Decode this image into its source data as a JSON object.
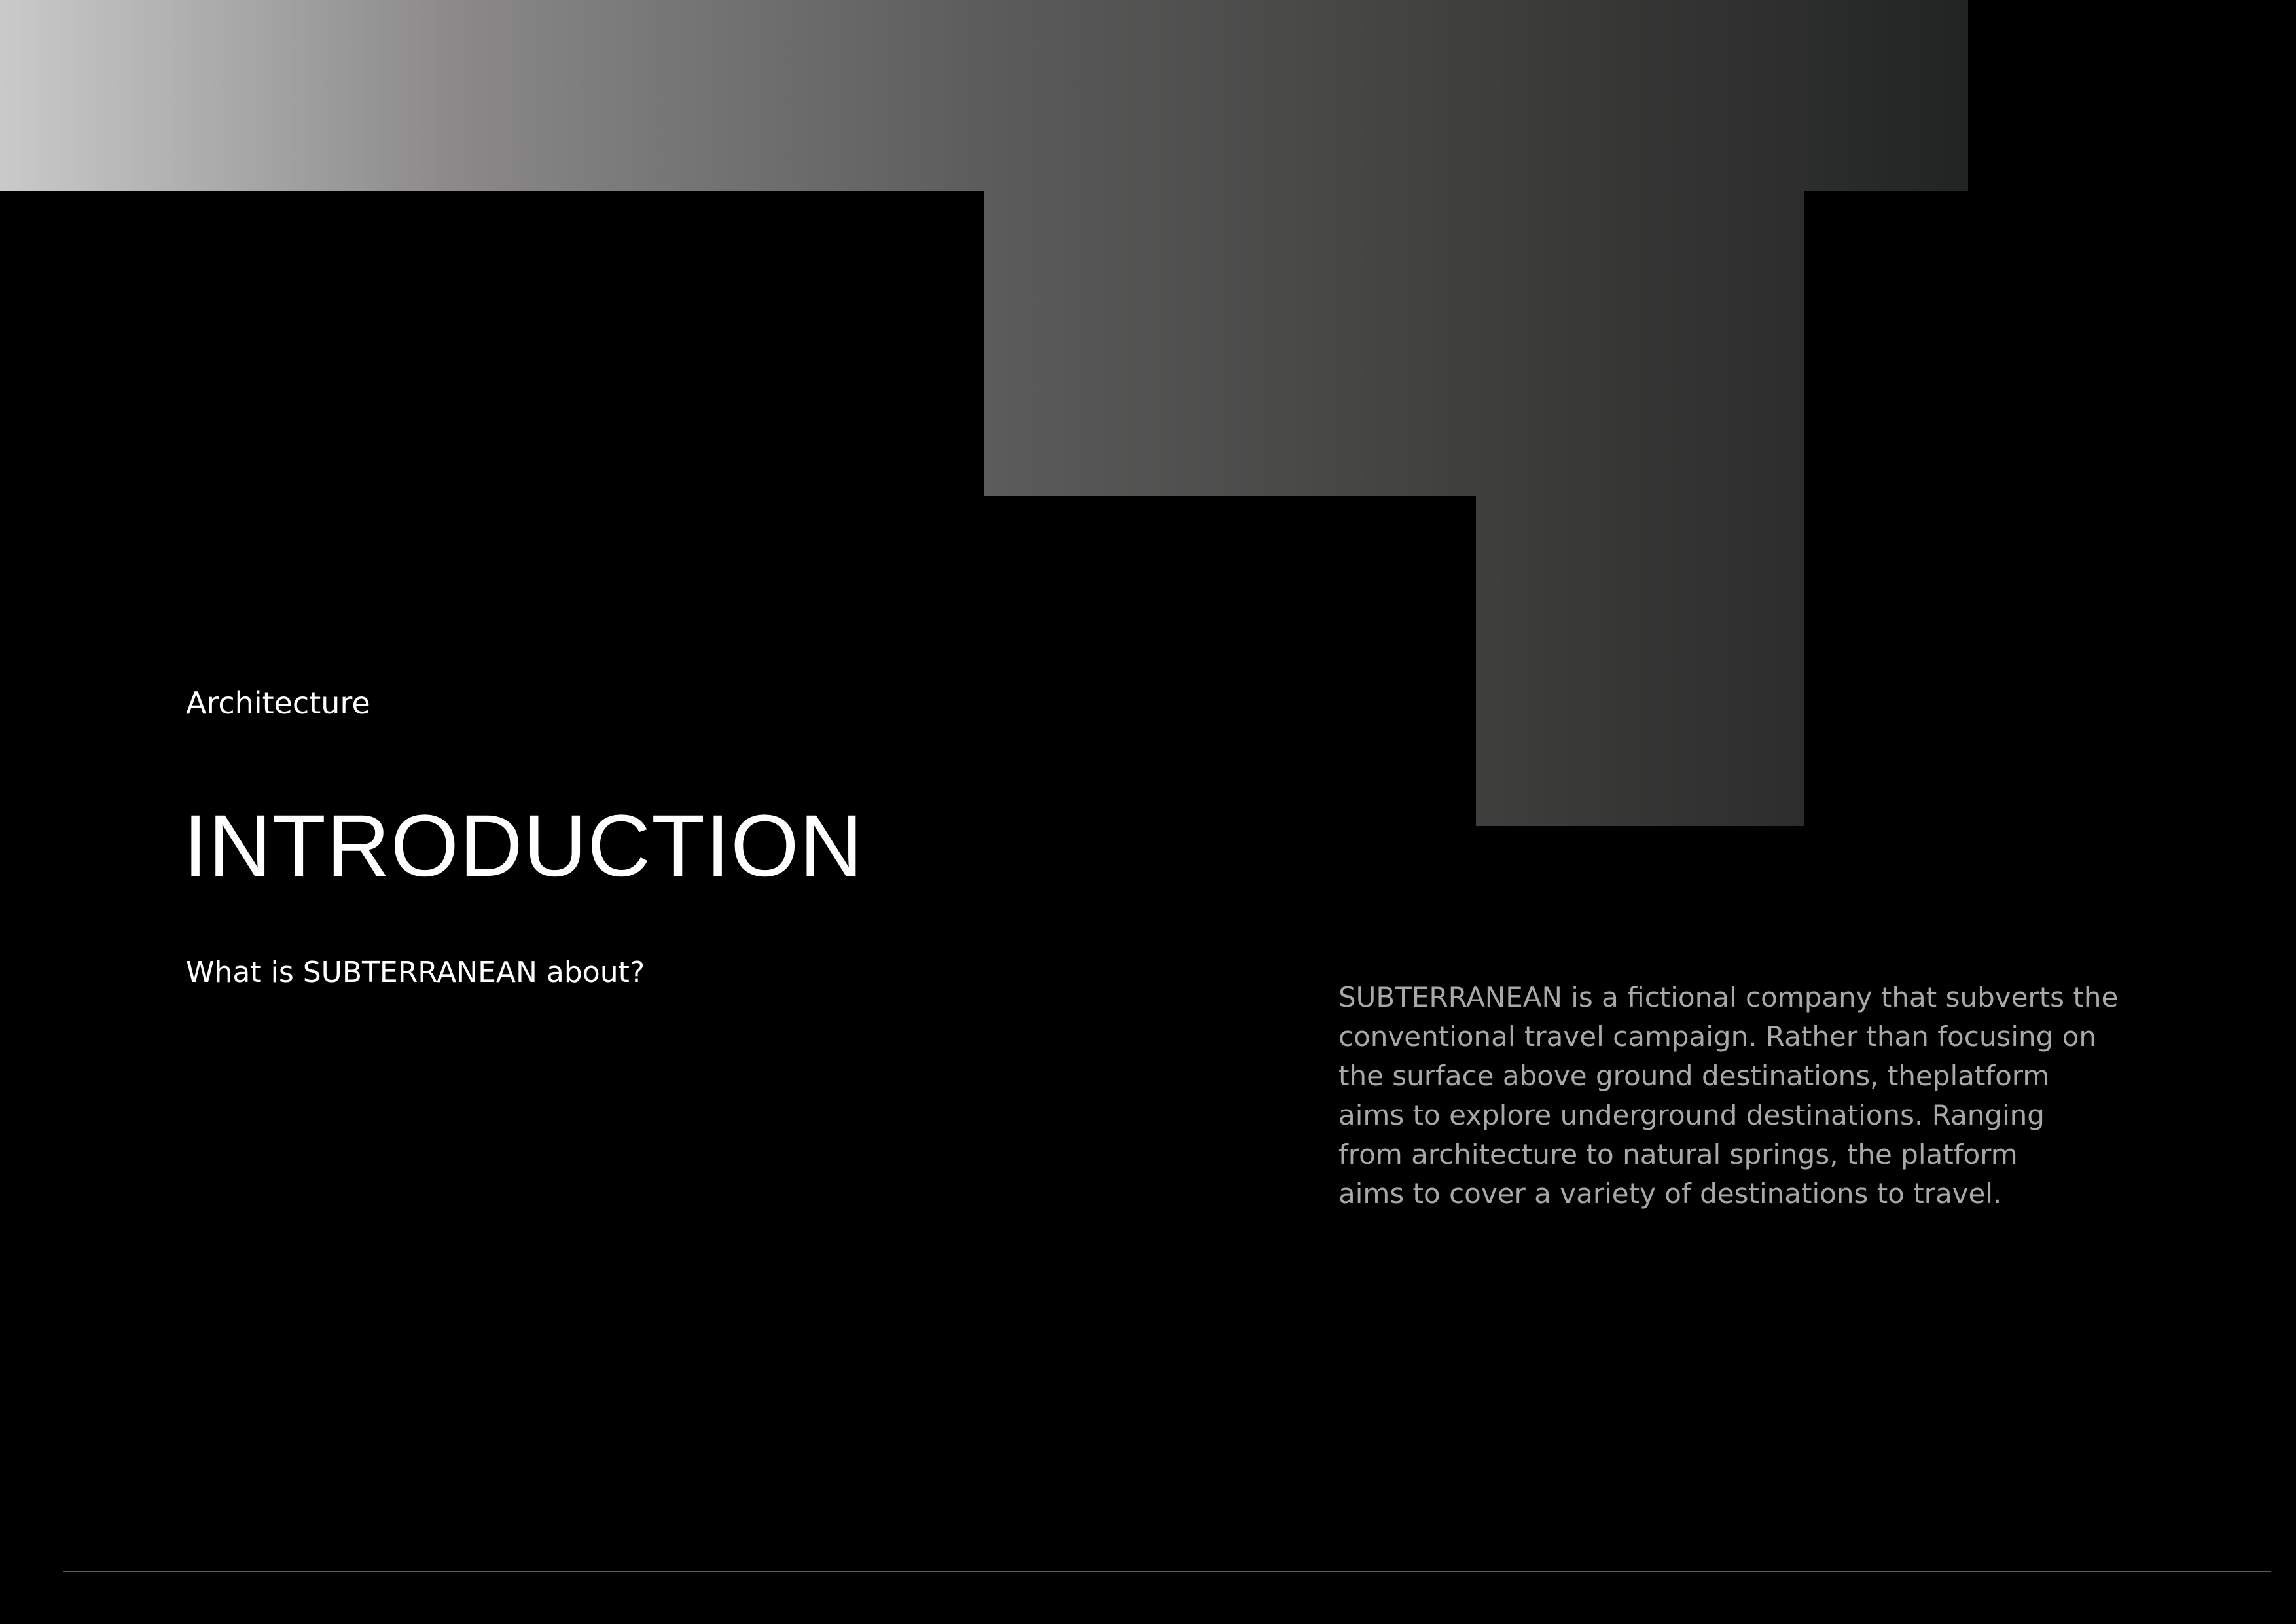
{
  "page": {
    "eyebrow": "Architecture",
    "title": "INTRODUCTION",
    "question": "What is SUBTERRANEAN about?",
    "body_lines": [
      "SUBTERRANEAN is a fictional company that subverts the",
      "conventional travel campaign. Rather than focusing on",
      "the surface above ground destinations, theplatform",
      "aims to explore underground destinations. Ranging",
      "from architecture to natural springs, the platform",
      "aims to cover a variety of destinations to travel."
    ]
  },
  "colors": {
    "background": "#000000",
    "heading_text": "#ffffff",
    "body_text": "#a8a8a8",
    "gradient_light": "#cacaca",
    "gradient_dark": "#222424",
    "rule": "#5a5a5a"
  }
}
